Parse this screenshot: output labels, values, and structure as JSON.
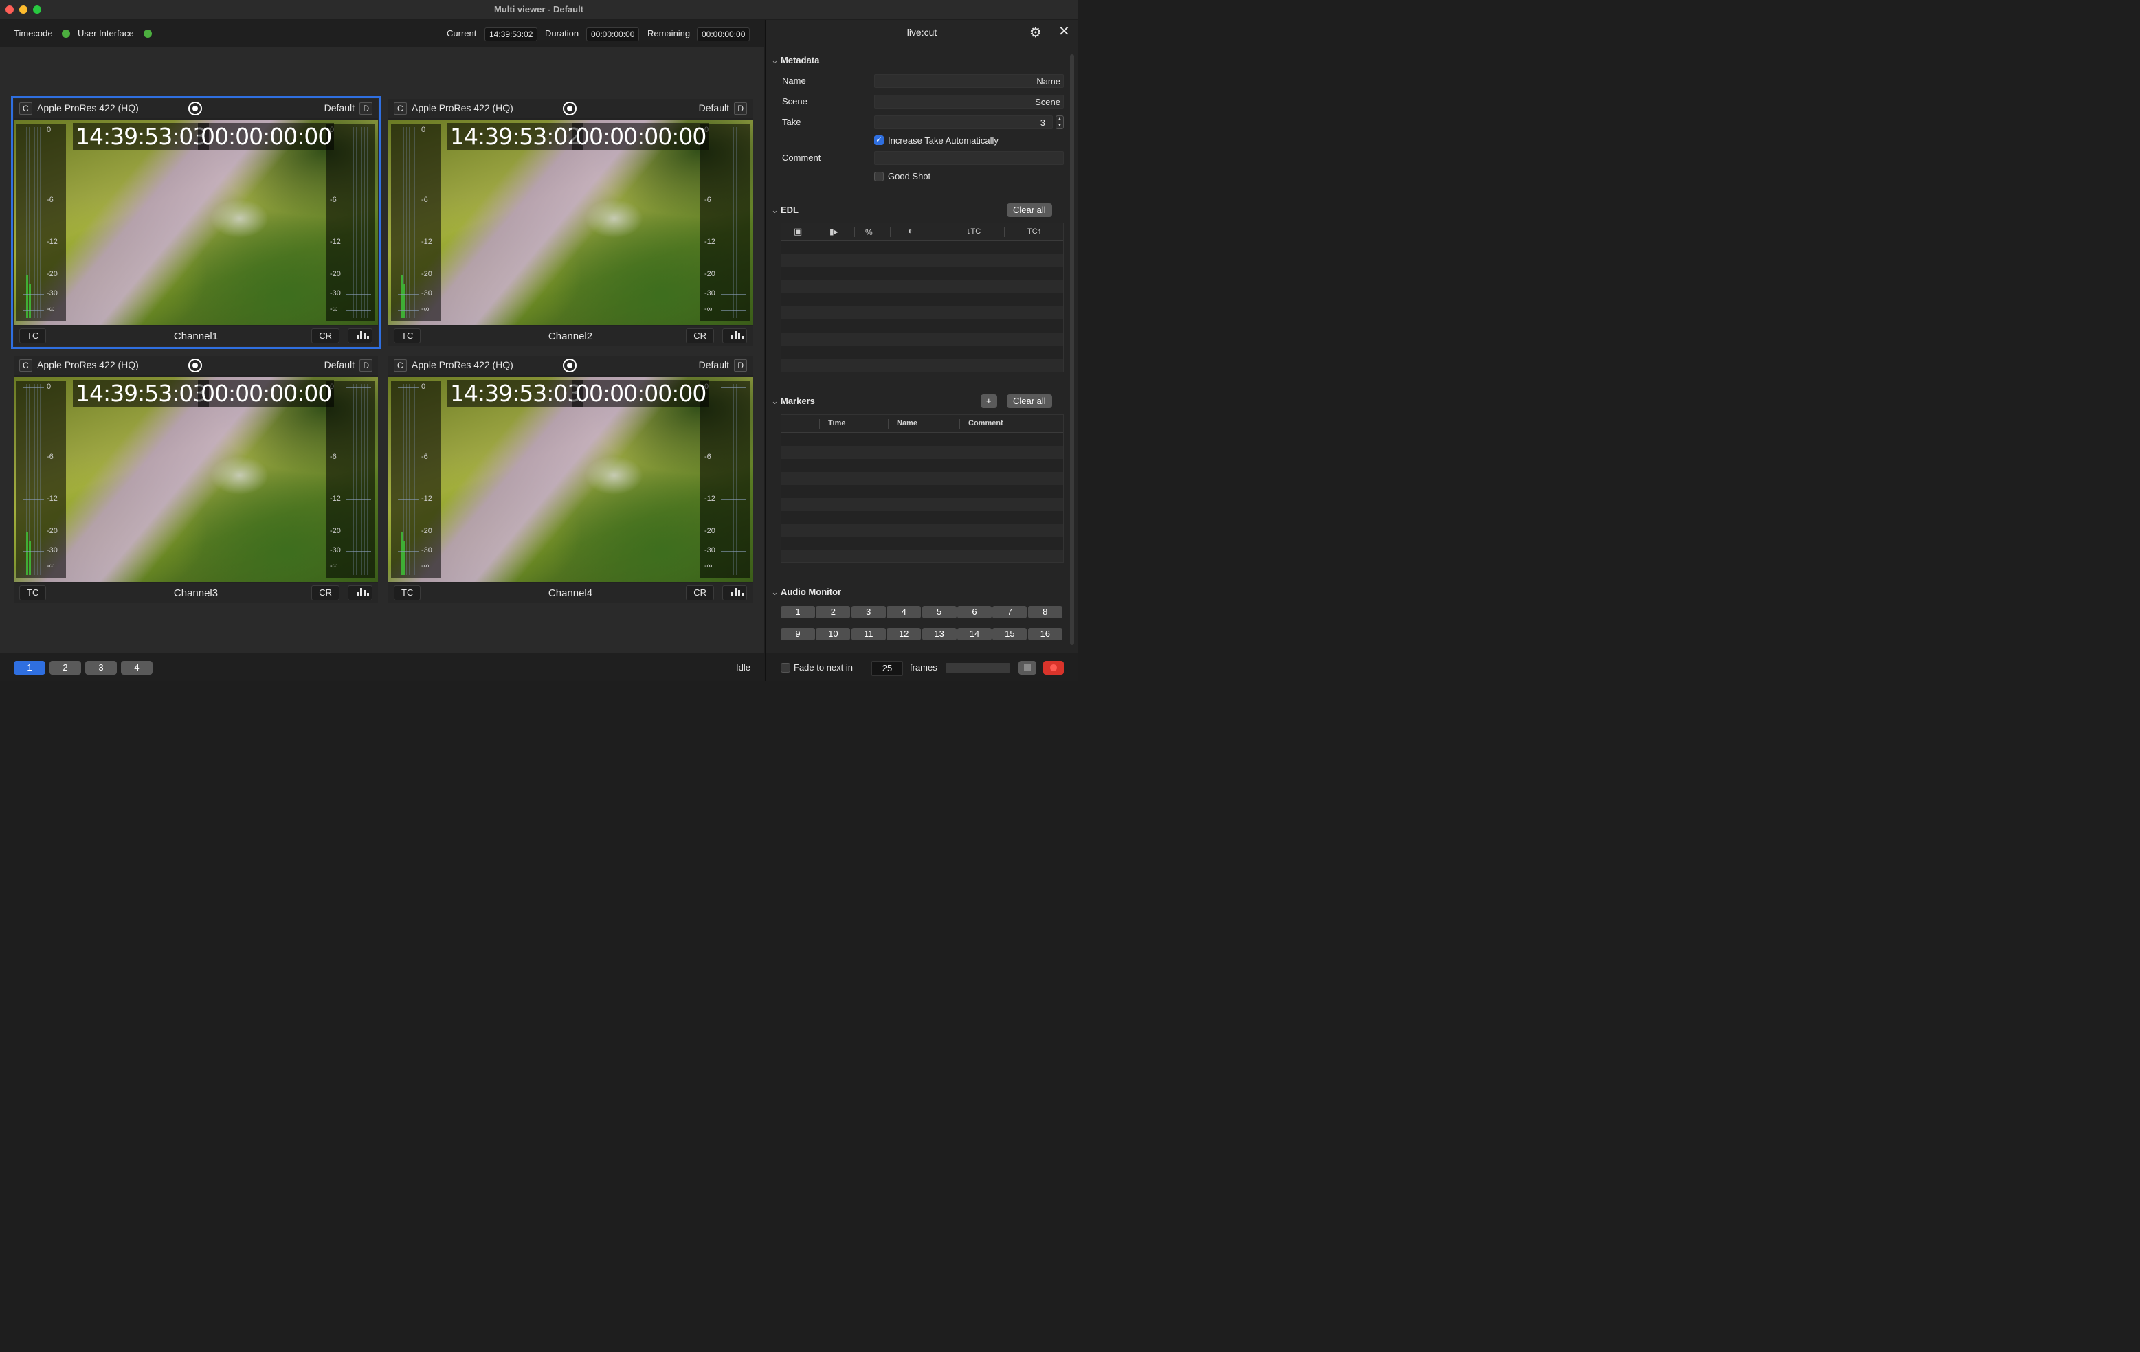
{
  "window": {
    "title": "Multi viewer - Default"
  },
  "status": {
    "timecode_label": "Timecode",
    "ui_label": "User Interface",
    "current_label": "Current",
    "current_value": "14:39:53:02",
    "duration_label": "Duration",
    "duration_value": "00:00:00:00",
    "remaining_label": "Remaining",
    "remaining_value": "00:00:00:00",
    "led_color": "#4caf3f"
  },
  "channels": [
    {
      "c": "C",
      "codec": "Apple ProRes 422 (HQ)",
      "preset": "Default",
      "d": "D",
      "tc": "14:39:53:03",
      "dur": "00:00:00:00",
      "tc_btn": "TC",
      "cr_btn": "CR",
      "name": "Channel1",
      "selected": true
    },
    {
      "c": "C",
      "codec": "Apple ProRes 422 (HQ)",
      "preset": "Default",
      "d": "D",
      "tc": "14:39:53:02",
      "dur": "00:00:00:00",
      "tc_btn": "TC",
      "cr_btn": "CR",
      "name": "Channel2",
      "selected": false
    },
    {
      "c": "C",
      "codec": "Apple ProRes 422 (HQ)",
      "preset": "Default",
      "d": "D",
      "tc": "14:39:53:03",
      "dur": "00:00:00:00",
      "tc_btn": "TC",
      "cr_btn": "CR",
      "name": "Channel3",
      "selected": false
    },
    {
      "c": "C",
      "codec": "Apple ProRes 422 (HQ)",
      "preset": "Default",
      "d": "D",
      "tc": "14:39:53:03",
      "dur": "00:00:00:00",
      "tc_btn": "TC",
      "cr_btn": "CR",
      "name": "Channel4",
      "selected": false
    }
  ],
  "meter_ticks": [
    "0",
    "-6",
    "-12",
    "-20",
    "-30",
    "-∞"
  ],
  "pages": [
    "1",
    "2",
    "3",
    "4"
  ],
  "active_page": "1",
  "state_text": "Idle",
  "panel": {
    "title": "live:cut",
    "metadata": {
      "title": "Metadata",
      "name_label": "Name",
      "name_placeholder": "Name",
      "scene_label": "Scene",
      "scene_placeholder": "Scene",
      "take_label": "Take",
      "take_value": "3",
      "auto_take_label": "Increase Take Automatically",
      "auto_take_checked": true,
      "comment_label": "Comment",
      "comment_value": "",
      "good_shot_label": "Good Shot",
      "good_shot_checked": false
    },
    "edl": {
      "title": "EDL",
      "clear_label": "Clear all",
      "columns": [
        "calendar-icon",
        "camera-icon",
        "%",
        "clock-icon",
        "↓TC",
        "TC↑"
      ],
      "col_percent": "%",
      "col_in": "↓TC",
      "col_out": "TC↑"
    },
    "markers": {
      "title": "Markers",
      "add_label": "+",
      "clear_label": "Clear all",
      "col_time": "Time",
      "col_name": "Name",
      "col_comment": "Comment"
    },
    "audio": {
      "title": "Audio Monitor",
      "channels": [
        "1",
        "2",
        "3",
        "4",
        "5",
        "6",
        "7",
        "8",
        "9",
        "10",
        "11",
        "12",
        "13",
        "14",
        "15",
        "16"
      ]
    },
    "footer": {
      "fade_label": "Fade to next in",
      "fade_checked": false,
      "frames_value": "25",
      "frames_label": "frames",
      "rec_color": "#d9342b"
    }
  }
}
